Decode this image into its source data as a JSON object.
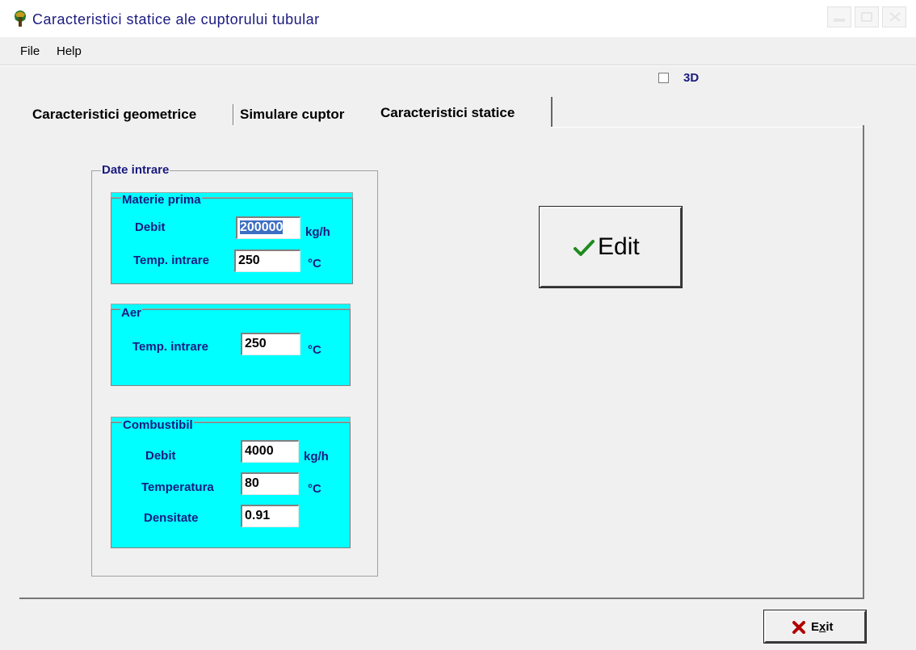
{
  "window": {
    "title": "Caracteristici statice ale cuptorului tubular"
  },
  "menu": {
    "items": [
      "File",
      "Help"
    ]
  },
  "options": {
    "checkbox_3d_label": "3D",
    "checkbox_3d_checked": false
  },
  "tabs": [
    {
      "label": "Caracteristici geometrice",
      "active": false
    },
    {
      "label": "Simulare cuptor",
      "active": false
    },
    {
      "label": "Caracteristici statice",
      "active": true
    }
  ],
  "date_intrare": {
    "legend": "Date intrare",
    "materie_prima": {
      "legend": "Materie prima",
      "debit_label": "Debit",
      "debit_value": "200000",
      "debit_unit": "kg/h",
      "temp_label": "Temp. intrare",
      "temp_value": "250",
      "temp_unit": "°C"
    },
    "aer": {
      "legend": "Aer",
      "temp_label": "Temp. intrare",
      "temp_value": "250",
      "temp_unit": "°C"
    },
    "combustibil": {
      "legend": "Combustibil",
      "debit_label": "Debit",
      "debit_value": "4000",
      "debit_unit": "kg/h",
      "temp_label": "Temperatura",
      "temp_value": "80",
      "temp_unit": "°C",
      "dens_label": "Densitate",
      "dens_value": "0.91"
    }
  },
  "buttons": {
    "edit_label": "Edit",
    "exit_label_pre": "E",
    "exit_label_mnemonic": "x",
    "exit_label_post": "it"
  },
  "colors": {
    "accent_cyan": "#00ffff",
    "label_navy": "#1a1a80",
    "check_green": "#1f8a1f",
    "exit_x_red": "#b00000",
    "selection_blue": "#3b6fc4"
  },
  "icons": {
    "app": "furnace-app-icon",
    "edit": "checkmark-icon",
    "exit": "x-mark-icon"
  }
}
